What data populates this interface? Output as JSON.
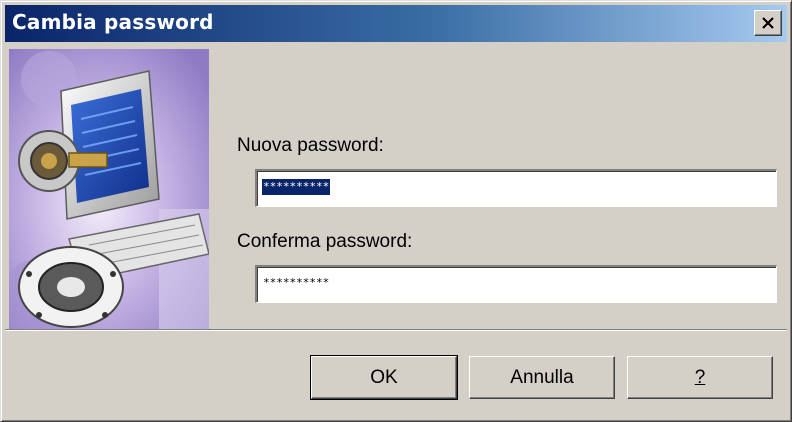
{
  "window": {
    "title": "Cambia password"
  },
  "icons": {
    "close": "close-icon",
    "illustration": "computer-lock-illustration-icon"
  },
  "form": {
    "new_password": {
      "label": "Nuova password:",
      "value": "**********",
      "selected": true
    },
    "confirm_password": {
      "label": "Conferma password:",
      "value": "**********"
    }
  },
  "buttons": {
    "ok": "OK",
    "cancel": "Annulla",
    "help": "?"
  },
  "colors": {
    "title_start": "#0a246a",
    "title_end": "#a6caf0",
    "face": "#d4d0c8",
    "selection": "#0a246a"
  }
}
